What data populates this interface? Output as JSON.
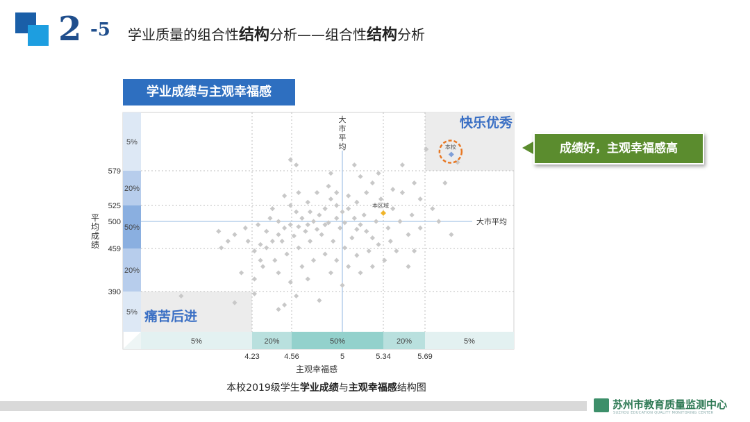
{
  "header": {
    "number": "2",
    "subnumber": "-5",
    "title_parts": [
      "学业质量的组合性",
      "结构",
      "分析——组合性",
      "结构",
      "分析"
    ]
  },
  "chart_title_box": "学业成绩与主观幸福感",
  "callout": "成绩好，主观幸福感高",
  "caption_parts": [
    "本校2019级学生",
    "学业成绩",
    "与",
    "主观幸福感",
    "结构图"
  ],
  "footer": {
    "org": "苏州市教育质量监测中心",
    "org_en": "SUZHOU EDUCATION QUALITY MONITORING CENTER"
  },
  "colors": {
    "title_blue": "#2e6fc0",
    "callout_green": "#5b8c2e",
    "region_label_blue": "#3a6fc4",
    "point_gray": "#c8c8c8",
    "school_blue": "#7f9fd8",
    "district_orange": "#f0b429"
  },
  "chart_data": {
    "type": "scatter",
    "xlabel": "主观幸福感",
    "ylabel": "平均成绩",
    "x_ticks": [
      4.23,
      4.56,
      5,
      5.34,
      5.69
    ],
    "y_ticks": [
      579,
      525,
      500,
      459,
      390
    ],
    "x_band_labels": [
      "5%",
      "20%",
      "50%",
      "20%",
      "5%"
    ],
    "y_band_labels": [
      "5%",
      "20%",
      "50%",
      "20%",
      "5%"
    ],
    "city_avg_label_vertical": "大市平均",
    "city_avg_label_horizontal": "大市平均",
    "city_avg": {
      "x": 5,
      "y": 500
    },
    "quadrant_top_right": "快乐优秀",
    "quadrant_bottom_left": "痛苦后进",
    "school": {
      "label": "本校",
      "x": 5.9,
      "y": 610
    },
    "district": {
      "label": "本区域",
      "x": 5.34,
      "y": 513
    },
    "points": [
      [
        5.7,
        620
      ],
      [
        5.95,
        595
      ],
      [
        5.85,
        560
      ],
      [
        5.6,
        560
      ],
      [
        5.5,
        545
      ],
      [
        5.65,
        535
      ],
      [
        5.75,
        520
      ],
      [
        5.8,
        500
      ],
      [
        5.65,
        490
      ],
      [
        5.55,
        480
      ],
      [
        5.4,
        470
      ],
      [
        5.45,
        455
      ],
      [
        5.35,
        440
      ],
      [
        5.55,
        430
      ],
      [
        5.9,
        480
      ],
      [
        5.3,
        575
      ],
      [
        5.25,
        560
      ],
      [
        5.15,
        570
      ],
      [
        5.1,
        590
      ],
      [
        5.2,
        545
      ],
      [
        5.12,
        530
      ],
      [
        5.05,
        520
      ],
      [
        5.0,
        515
      ],
      [
        4.95,
        525
      ],
      [
        4.9,
        535
      ],
      [
        4.85,
        520
      ],
      [
        4.8,
        510
      ],
      [
        4.75,
        500
      ],
      [
        4.7,
        495
      ],
      [
        4.65,
        505
      ],
      [
        4.6,
        515
      ],
      [
        4.55,
        495
      ],
      [
        4.5,
        490
      ],
      [
        4.45,
        480
      ],
      [
        4.4,
        470
      ],
      [
        4.35,
        460
      ],
      [
        4.3,
        465
      ],
      [
        4.25,
        455
      ],
      [
        4.2,
        470
      ],
      [
        4.1,
        480
      ],
      [
        4.05,
        470
      ],
      [
        4.0,
        460
      ],
      [
        4.35,
        485
      ],
      [
        4.45,
        500
      ],
      [
        4.55,
        525
      ],
      [
        4.5,
        540
      ],
      [
        4.62,
        545
      ],
      [
        4.7,
        530
      ],
      [
        4.78,
        545
      ],
      [
        4.88,
        555
      ],
      [
        4.95,
        545
      ],
      [
        5.05,
        540
      ],
      [
        5.1,
        505
      ],
      [
        5.15,
        495
      ],
      [
        5.2,
        485
      ],
      [
        5.25,
        475
      ],
      [
        5.3,
        465
      ],
      [
        5.22,
        455
      ],
      [
        5.12,
        448
      ],
      [
        5.02,
        460
      ],
      [
        4.92,
        470
      ],
      [
        4.82,
        480
      ],
      [
        4.72,
        470
      ],
      [
        4.62,
        460
      ],
      [
        4.52,
        450
      ],
      [
        4.42,
        440
      ],
      [
        4.32,
        430
      ],
      [
        4.25,
        410
      ],
      [
        4.45,
        420
      ],
      [
        4.55,
        405
      ],
      [
        4.65,
        430
      ],
      [
        4.75,
        440
      ],
      [
        4.85,
        450
      ],
      [
        4.95,
        440
      ],
      [
        5.05,
        430
      ],
      [
        5.15,
        420
      ],
      [
        5.25,
        430
      ],
      [
        4.6,
        380
      ],
      [
        4.8,
        370
      ],
      [
        4.5,
        360
      ],
      [
        4.1,
        365
      ],
      [
        4.15,
        420
      ],
      [
        4.45,
        350
      ],
      [
        4.9,
        420
      ],
      [
        4.7,
        410
      ],
      [
        5.0,
        400
      ],
      [
        5.08,
        475
      ],
      [
        4.98,
        490
      ],
      [
        4.88,
        498
      ],
      [
        4.78,
        488
      ],
      [
        4.68,
        485
      ],
      [
        4.58,
        478
      ],
      [
        4.48,
        470
      ],
      [
        5.18,
        510
      ],
      [
        5.28,
        500
      ],
      [
        5.38,
        490
      ],
      [
        5.48,
        500
      ],
      [
        5.58,
        510
      ],
      [
        5.42,
        520
      ],
      [
        5.32,
        535
      ],
      [
        4.38,
        505
      ],
      [
        4.28,
        495
      ],
      [
        4.18,
        490
      ],
      [
        3.98,
        485
      ],
      [
        4.55,
        600
      ],
      [
        4.6,
        590
      ],
      [
        4.4,
        520
      ],
      [
        5.42,
        550
      ],
      [
        4.95,
        505
      ],
      [
        4.85,
        495
      ],
      [
        5.02,
        498
      ],
      [
        5.12,
        488
      ],
      [
        4.72,
        515
      ],
      [
        4.62,
        492
      ],
      [
        5.6,
        455
      ],
      [
        4.25,
        385
      ],
      [
        3.7,
        380
      ],
      [
        5.5,
        590
      ],
      [
        4.9,
        575
      ],
      [
        4.3,
        440
      ]
    ]
  }
}
